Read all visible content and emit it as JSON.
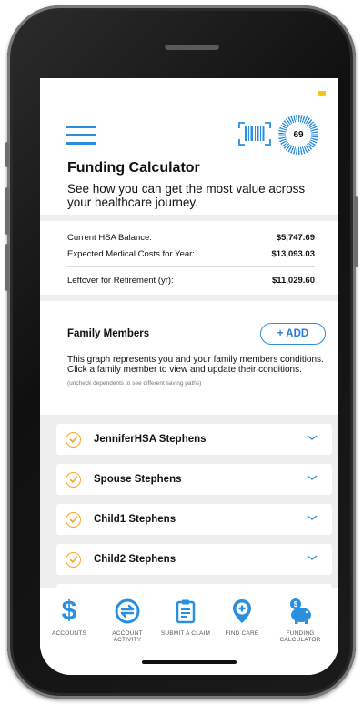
{
  "header": {
    "score": "69"
  },
  "page": {
    "title": "Funding Calculator",
    "subtitle": "See how you can get the most value across your healthcare journey."
  },
  "balances": [
    {
      "label": "Current HSA Balance:",
      "value": "$5,747.69"
    },
    {
      "label": "Expected Medical Costs for Year:",
      "value": "$13,093.03"
    },
    {
      "label": "Leftover for Retirement (yr):",
      "value": "$11,029.60"
    }
  ],
  "family": {
    "title": "Family Members",
    "add_label": "+ ADD",
    "description": "This graph represents you and your family members conditions. Click a family member to view and update their conditions.",
    "hint": "(uncheck dependents to see different saving paths)",
    "members": [
      {
        "name": "JenniferHSA Stephens",
        "checked": true
      },
      {
        "name": "Spouse Stephens",
        "checked": true
      },
      {
        "name": "Child1 Stephens",
        "checked": true
      },
      {
        "name": "Child2 Stephens",
        "checked": true
      }
    ]
  },
  "tabs": [
    {
      "label": "ACCOUNTS",
      "icon": "dollar-icon"
    },
    {
      "label": "ACCOUNT ACTIVITY",
      "icon": "transfer-icon"
    },
    {
      "label": "SUBMIT A CLAIM",
      "icon": "clipboard-icon"
    },
    {
      "label": "FIND CARE",
      "icon": "location-plus-icon"
    },
    {
      "label": "FUNDING CALCULATOR",
      "icon": "piggy-bank-icon"
    }
  ],
  "colors": {
    "accent": "#2b8fe0",
    "check": "#f5a623",
    "status": "#f5c518"
  }
}
